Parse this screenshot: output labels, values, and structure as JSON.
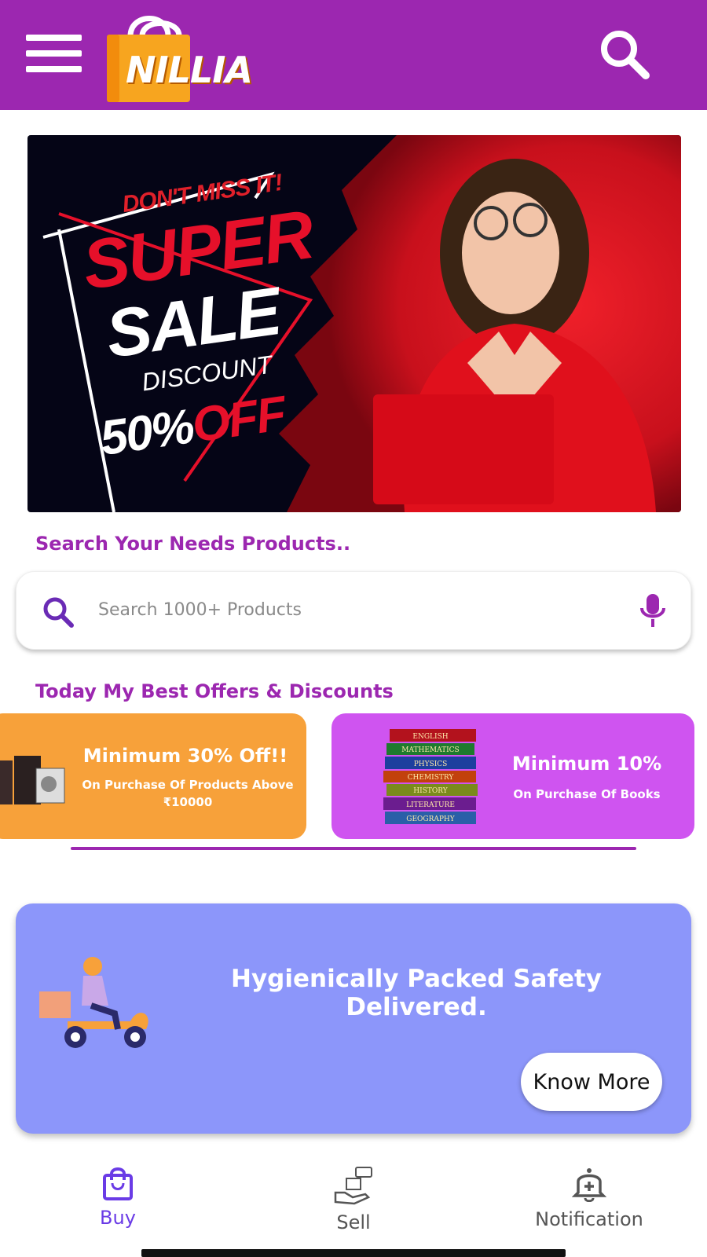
{
  "header": {
    "logo_text": "NILLIA",
    "menu_icon": "hamburger-menu-icon",
    "search_icon": "search-icon",
    "background_color": "#9c27b0"
  },
  "banner": {
    "dont_miss": "DON'T MISS IT!",
    "super": "SUPER",
    "sale": "SALE",
    "discount": "DISCOUNT",
    "percent": "50%",
    "off": "OFF"
  },
  "search_section": {
    "title": "Search Your Needs Products..",
    "placeholder": "Search 1000+ Products",
    "search_icon": "search-icon",
    "mic_icon": "microphone-icon"
  },
  "offers_section": {
    "title": "Today My Best Offers & Discounts",
    "offers": [
      {
        "title": "Minimum 30% Off!!",
        "subtitle": "On Purchase Of Products Above ₹10000",
        "color": "#f7a13a"
      },
      {
        "title": "Minimum 10%",
        "subtitle": "On Purchase Of Books",
        "color": "#cf54f0",
        "books": [
          "ENGLISH",
          "MATHEMATICS",
          "PHYSICS",
          "CHEMISTRY",
          "HISTORY",
          "LITERATURE",
          "GEOGRAPHY"
        ]
      }
    ]
  },
  "delivery": {
    "title": "Hygienically Packed Safety Delivered.",
    "button_label": "Know More",
    "color": "#8c96fa"
  },
  "bottom_nav": {
    "items": [
      {
        "label": "Buy",
        "icon": "shopping-bag-icon",
        "active": true
      },
      {
        "label": "Sell",
        "icon": "sell-hand-icon",
        "active": false
      },
      {
        "label": "Notification",
        "icon": "bell-icon",
        "active": false
      }
    ],
    "active_color": "#6a3be6"
  }
}
